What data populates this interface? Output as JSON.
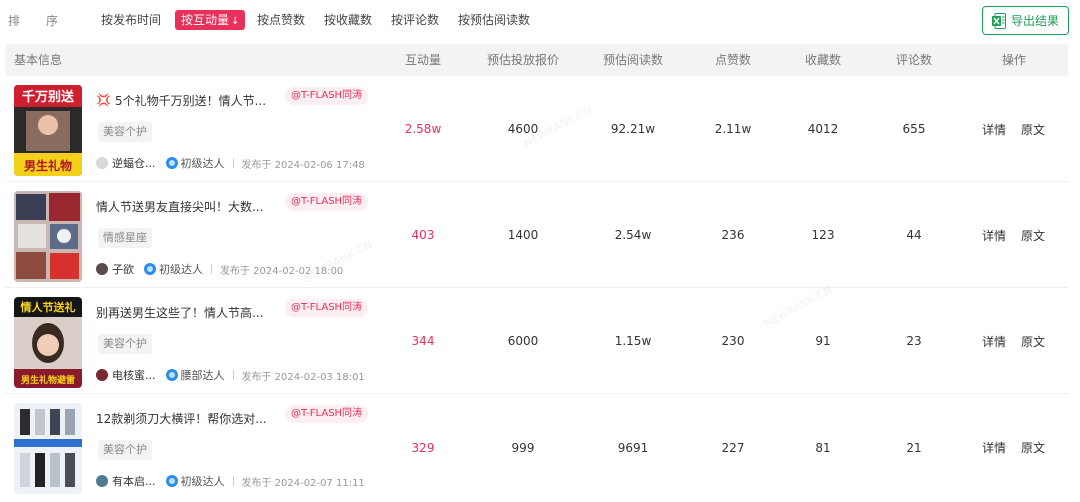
{
  "sortbar": {
    "label_chars": [
      "排",
      "序"
    ],
    "options": [
      {
        "label": "按发布时间",
        "active": false
      },
      {
        "label": "按互动量",
        "active": true
      },
      {
        "label": "按点赞数",
        "active": false
      },
      {
        "label": "按收藏数",
        "active": false
      },
      {
        "label": "按评论数",
        "active": false
      },
      {
        "label": "按预估阅读数",
        "active": false
      }
    ],
    "active_arrow": "↓",
    "export_label": "导出结果"
  },
  "table": {
    "headers": {
      "basic": "基本信息",
      "interaction": "互动量",
      "price": "预估投放报价",
      "reads": "预估阅读数",
      "likes": "点赞数",
      "favorites": "收藏数",
      "comments": "评论数",
      "actions": "操作"
    },
    "rows": [
      {
        "emoji": "💢",
        "title": "5个礼物千万别送！情人节...",
        "brand": "@T-FLASH同涛",
        "category": "美容个护",
        "author": "逆蝠仓...",
        "level": "初级达人",
        "published": "发布于 2024-02-06 17:48",
        "interaction": "2.58w",
        "price": "4600",
        "reads": "92.21w",
        "likes": "2.11w",
        "favorites": "4012",
        "comments": "655",
        "detail": "详情",
        "original": "原文"
      },
      {
        "emoji": "",
        "title": "情人节送男友直接尖叫！大数...",
        "brand": "@T-FLASH同涛",
        "category": "情感星座",
        "author": "子欲",
        "level": "初级达人",
        "published": "发布于 2024-02-02 18:00",
        "interaction": "403",
        "price": "1400",
        "reads": "2.54w",
        "likes": "236",
        "favorites": "123",
        "comments": "44",
        "detail": "详情",
        "original": "原文"
      },
      {
        "emoji": "",
        "title": "别再送男生这些了！情人节高...",
        "brand": "@T-FLASH同涛",
        "category": "美容个护",
        "author": "电核蜜...",
        "level": "腰部达人",
        "published": "发布于 2024-02-03 18:01",
        "interaction": "344",
        "price": "6000",
        "reads": "1.15w",
        "likes": "230",
        "favorites": "91",
        "comments": "23",
        "detail": "详情",
        "original": "原文"
      },
      {
        "emoji": "",
        "title": "12款剃须刀大横评！帮你选对...",
        "brand": "@T-FLASH同涛",
        "category": "美容个护",
        "author": "有本启...",
        "level": "初级达人",
        "published": "发布于 2024-02-07 11:11",
        "interaction": "329",
        "price": "999",
        "reads": "9691",
        "likes": "227",
        "favorites": "81",
        "comments": "21",
        "detail": "详情",
        "original": "原文"
      }
    ],
    "thumb_texts": [
      {
        "top": "千万别送",
        "bottom": "男生礼物"
      },
      {
        "top": "",
        "bottom": ""
      },
      {
        "top": "情人节送礼",
        "bottom": "男生礼物避雷"
      },
      {
        "top": "",
        "bottom": ""
      }
    ]
  },
  "colors": {
    "accent": "#e8305a",
    "export_green": "#1f9e57",
    "header_bg": "#f2f3f5"
  },
  "watermark": "NEWRANK.CN"
}
